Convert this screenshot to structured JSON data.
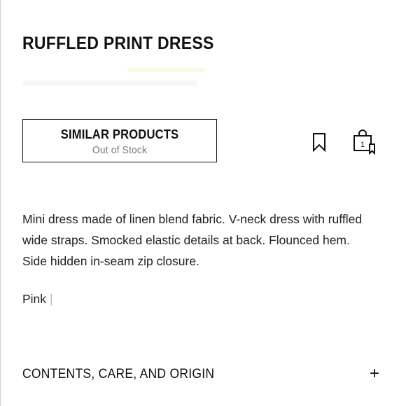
{
  "product": {
    "title": "RUFFLED PRINT DRESS",
    "description": "Mini dress made of linen blend fabric. V-neck dress with ruffled wide straps. Smocked elastic details at back. Flounced hem. Side hidden in-seam zip closure.",
    "color": "Pink",
    "color_separator": "|"
  },
  "actions": {
    "similar_label": "SIMILAR PRODUCTS",
    "similar_sub": "Out of Stock",
    "bag_count": "1",
    "bookmark_icon": "bookmark-icon",
    "bag_icon": "shopping-bag-icon"
  },
  "accordion": {
    "contents_label": "CONTENTS, CARE, AND ORIGIN",
    "toggle_symbol": "+"
  }
}
